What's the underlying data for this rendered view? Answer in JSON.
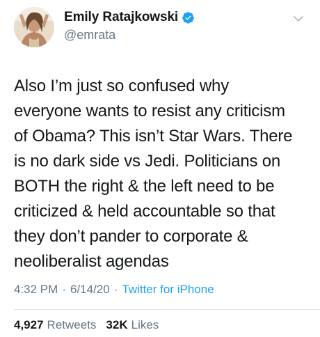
{
  "author": {
    "display_name": "Emily Ratajkowski",
    "handle": "@emrata",
    "verified": true
  },
  "tweet": {
    "text": "Also I’m just so confused why\neveryone wants to resist any criticism\nof Obama? This isn’t Star Wars. There\nis no dark side vs Jedi. Politicians on\nBOTH the right & the left need to be\ncriticized & held accountable so that\nthey don’t pander to corporate &\nneoliberalist agendas",
    "time": "4:32 PM",
    "date": "6/14/20",
    "separator": "·",
    "source": "Twitter for iPhone"
  },
  "stats": {
    "retweets_count": "4,927",
    "retweets_label": "Retweets",
    "likes_count": "32K",
    "likes_label": "Likes"
  },
  "colors": {
    "text": "#14171a",
    "secondary": "#657786",
    "accent": "#1da1f2",
    "divider": "#e1e8ed"
  },
  "icons": {
    "verified": "verified-badge-icon",
    "menu": "chevron-down-icon"
  }
}
